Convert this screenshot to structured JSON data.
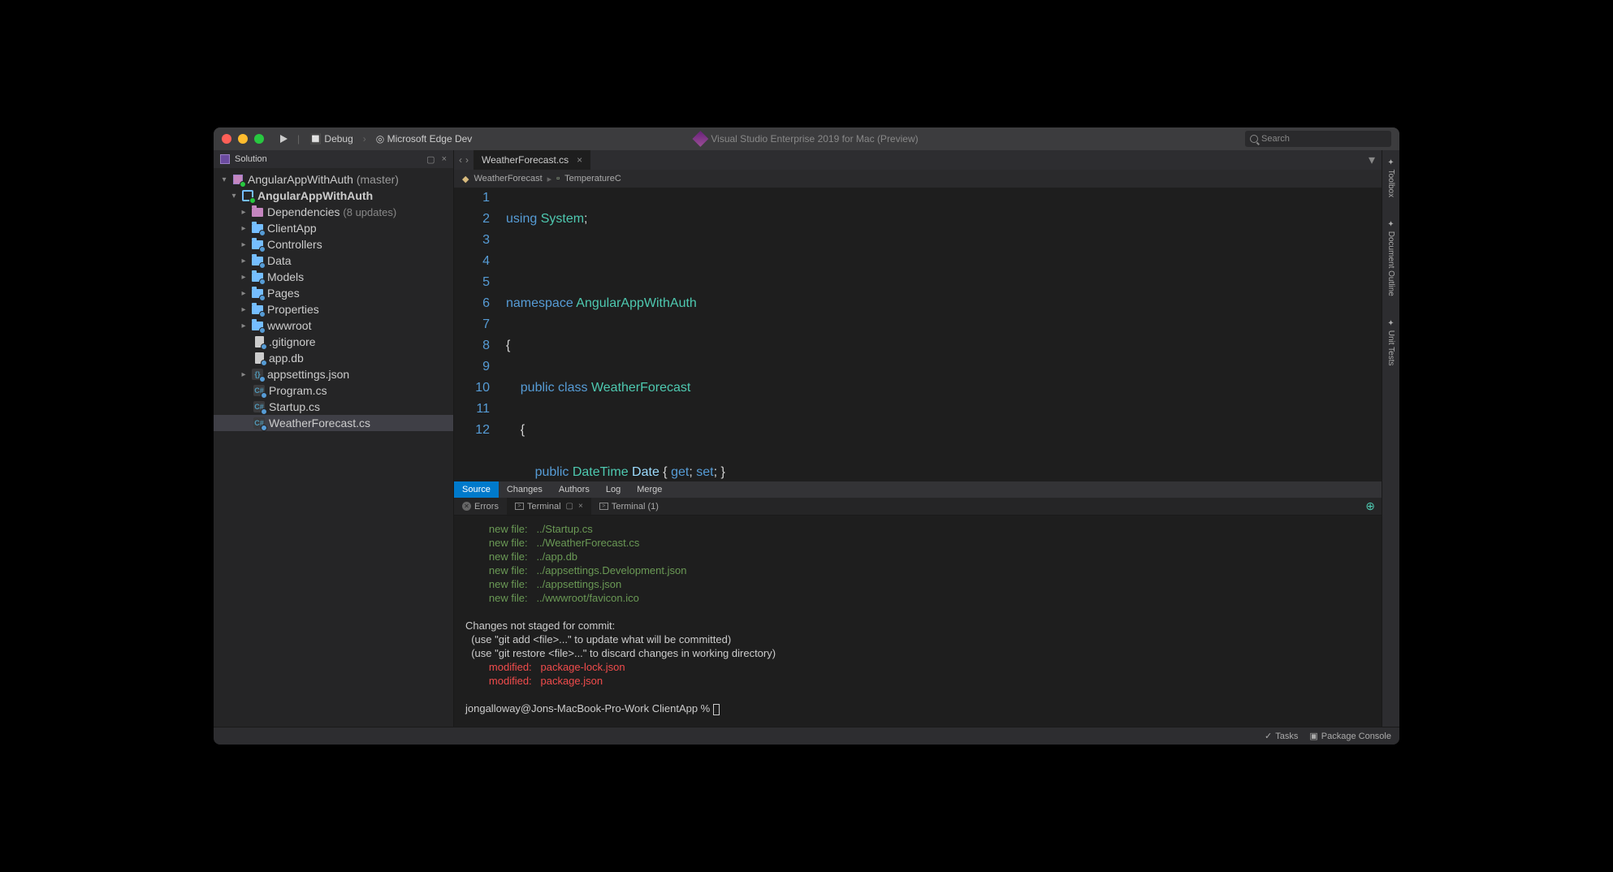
{
  "titlebar": {
    "config": "Debug",
    "target": "Microsoft Edge Dev",
    "title": "Visual Studio Enterprise 2019 for Mac (Preview)",
    "search_placeholder": "Search"
  },
  "sidebar": {
    "header": "Solution",
    "solution": {
      "name": "AngularAppWithAuth",
      "branch": "(master)"
    },
    "project": "AngularAppWithAuth",
    "dependencies_label": "Dependencies",
    "dependencies_updates": "(8 updates)",
    "folders": [
      "ClientApp",
      "Controllers",
      "Data",
      "Models",
      "Pages",
      "Properties",
      "wwwroot"
    ],
    "files": {
      "gitignore": ".gitignore",
      "appdb": "app.db",
      "appsettings": "appsettings.json",
      "program": "Program.cs",
      "startup": "Startup.cs",
      "weather": "WeatherForecast.cs"
    }
  },
  "editor": {
    "tab": "WeatherForecast.cs",
    "breadcrumb": {
      "class": "WeatherForecast",
      "member": "TemperatureC"
    },
    "lines": [
      "1",
      "2",
      "3",
      "4",
      "5",
      "6",
      "7",
      "8",
      "9",
      "10",
      "11",
      "12"
    ]
  },
  "blame": {
    "tabs": [
      "Source",
      "Changes",
      "Authors",
      "Log",
      "Merge"
    ],
    "active": 0
  },
  "panel": {
    "tabs": {
      "errors": "Errors",
      "terminal": "Terminal",
      "terminal2": "Terminal (1)"
    },
    "active": "terminal"
  },
  "terminal": {
    "new_files": [
      "../Startup.cs",
      "../WeatherForecast.cs",
      "../app.db",
      "../appsettings.Development.json",
      "../appsettings.json",
      "../wwwroot/favicon.ico"
    ],
    "new_file_label": "new file:",
    "unstaged_header": "Changes not staged for commit:",
    "unstaged_hint1": "  (use \"git add <file>...\" to update what will be committed)",
    "unstaged_hint2": "  (use \"git restore <file>...\" to discard changes in working directory)",
    "modified_label": "modified:",
    "modified": [
      "package-lock.json",
      "package.json"
    ],
    "prompt": "jongalloway@Jons-MacBook-Pro-Work ClientApp % "
  },
  "toolbox_tabs": [
    "Toolbox",
    "Document Outline",
    "Unit Tests"
  ],
  "statusbar": {
    "tasks": "Tasks",
    "package": "Package Console"
  }
}
